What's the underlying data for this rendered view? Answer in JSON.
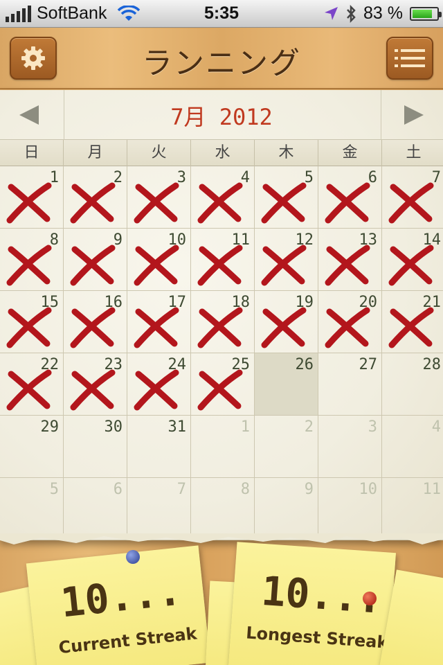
{
  "status_bar": {
    "carrier": "SoftBank",
    "time": "5:35",
    "battery": "83 %",
    "battery_level": 0.83
  },
  "header": {
    "title": "ランニング",
    "settings_icon": "gear-icon",
    "menu_icon": "list-icon"
  },
  "calendar": {
    "month_title": "7月 2012",
    "prev_icon": "arrow-left-icon",
    "next_icon": "arrow-right-icon",
    "weekdays": [
      "日",
      "月",
      "火",
      "水",
      "木",
      "金",
      "土"
    ],
    "days": [
      {
        "n": "1",
        "x": true
      },
      {
        "n": "2",
        "x": true
      },
      {
        "n": "3",
        "x": true
      },
      {
        "n": "4",
        "x": true
      },
      {
        "n": "5",
        "x": true
      },
      {
        "n": "6",
        "x": true
      },
      {
        "n": "7",
        "x": true
      },
      {
        "n": "8",
        "x": true
      },
      {
        "n": "9",
        "x": true
      },
      {
        "n": "10",
        "x": true
      },
      {
        "n": "11",
        "x": true
      },
      {
        "n": "12",
        "x": true
      },
      {
        "n": "13",
        "x": true
      },
      {
        "n": "14",
        "x": true
      },
      {
        "n": "15",
        "x": true
      },
      {
        "n": "16",
        "x": true
      },
      {
        "n": "17",
        "x": true
      },
      {
        "n": "18",
        "x": true
      },
      {
        "n": "19",
        "x": true
      },
      {
        "n": "20",
        "x": true
      },
      {
        "n": "21",
        "x": true
      },
      {
        "n": "22",
        "x": true
      },
      {
        "n": "23",
        "x": true
      },
      {
        "n": "24",
        "x": true
      },
      {
        "n": "25",
        "x": true
      },
      {
        "n": "26",
        "x": false,
        "today": true
      },
      {
        "n": "27",
        "x": false
      },
      {
        "n": "28",
        "x": false
      },
      {
        "n": "29",
        "x": false
      },
      {
        "n": "30",
        "x": false
      },
      {
        "n": "31",
        "x": false
      },
      {
        "n": "1",
        "x": false,
        "other": true
      },
      {
        "n": "2",
        "x": false,
        "other": true
      },
      {
        "n": "3",
        "x": false,
        "other": true
      },
      {
        "n": "4",
        "x": false,
        "other": true
      },
      {
        "n": "5",
        "x": false,
        "other": true
      },
      {
        "n": "6",
        "x": false,
        "other": true
      },
      {
        "n": "7",
        "x": false,
        "other": true
      },
      {
        "n": "8",
        "x": false,
        "other": true
      },
      {
        "n": "9",
        "x": false,
        "other": true
      },
      {
        "n": "10",
        "x": false,
        "other": true
      },
      {
        "n": "11",
        "x": false,
        "other": true
      }
    ],
    "mark_color": "#b3161c"
  },
  "streaks": {
    "current_value": "10...",
    "current_label": "Current Streak",
    "longest_value": "10...",
    "longest_label": "Longest Streak"
  }
}
